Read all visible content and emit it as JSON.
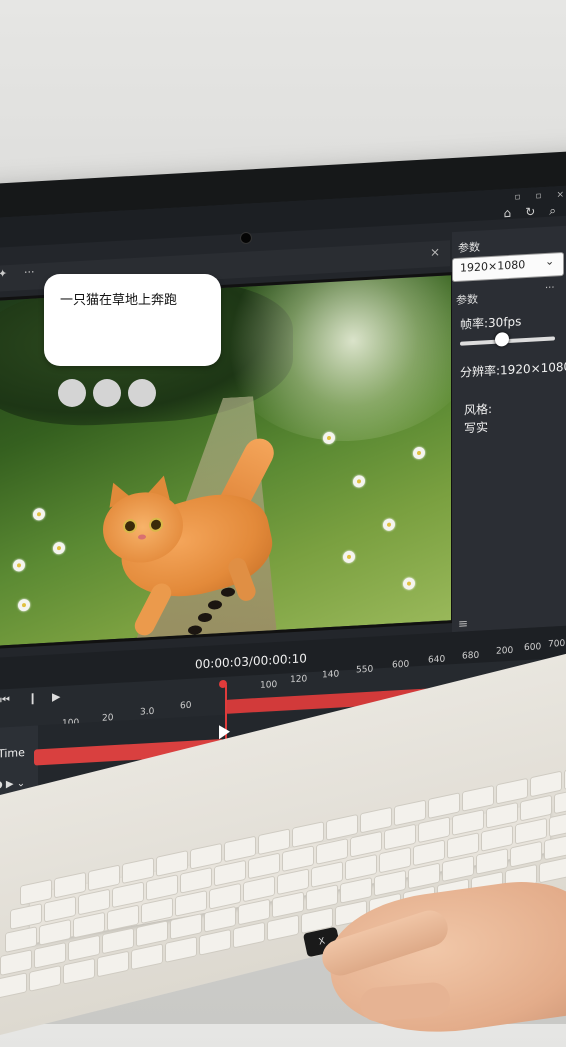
{
  "prompt_bubble": {
    "text": "一只猫在草地上奔跑"
  },
  "window": {
    "controls": "▫ ▫ ×",
    "close": "×"
  },
  "toolbar": {
    "left_icon": "✦",
    "more": "···"
  },
  "toolbar_icons": [
    "home-icon",
    "refresh-icon",
    "search-icon"
  ],
  "panel": {
    "title": "参数",
    "resolution_select": "1920×1080",
    "section": "参数",
    "frame_rate": "帧率:30fps",
    "frame_rate_slider": 0.4,
    "resolution": "分辨率:1920×1080",
    "style_label": "风格:",
    "style_value": "写实"
  },
  "timeline": {
    "timecode": "00:00:03/00:00:10",
    "track_label": "Time",
    "ruler_top": [
      "100",
      "120",
      "140",
      "550",
      "600",
      "640",
      "680",
      "200",
      "600",
      "700"
    ],
    "ruler_bottom": [
      "100",
      "20",
      "3.0",
      "60"
    ],
    "playhead_position": 0.3
  },
  "keyboard": {
    "pressed_key": "X"
  },
  "colors": {
    "accent": "#d9403f",
    "panel_bg": "#2b2e34",
    "screen_bg": "#23262b"
  }
}
